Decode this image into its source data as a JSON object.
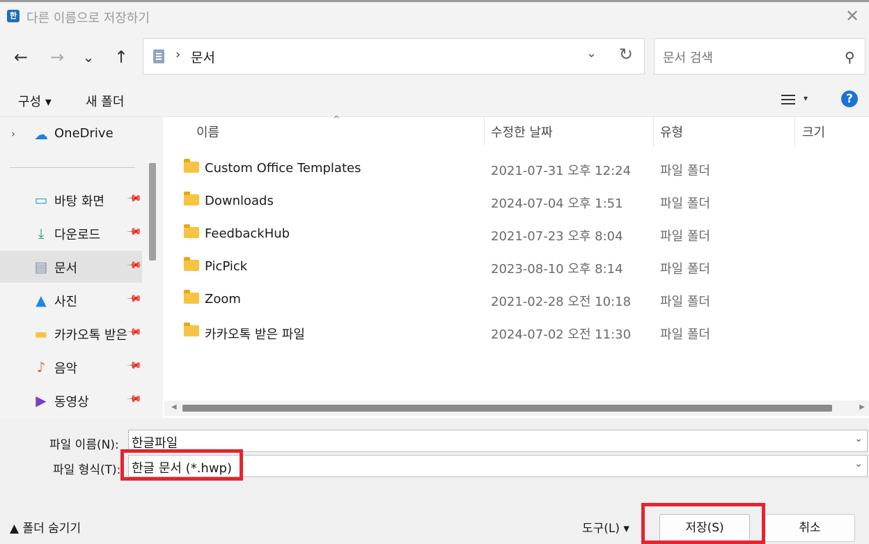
{
  "window": {
    "title": "다른 이름으로 저장하기",
    "app_icon_glyph": "한",
    "close_glyph": "✕"
  },
  "nav": {
    "back_glyph": "←",
    "forward_glyph": "→",
    "recent_glyph": "⌄",
    "up_glyph": "↑",
    "address": {
      "separator": "›",
      "path": "문서",
      "dropdown_glyph": "⌄",
      "refresh_glyph": "↻"
    },
    "search": {
      "placeholder": "문서 검색",
      "icon_glyph": "⚲"
    }
  },
  "commandbar": {
    "organize": "구성 ▾",
    "new_folder": "새 폴더",
    "view_caret": "▾",
    "help_glyph": "?"
  },
  "sidebar": {
    "onedrive": {
      "chevron": "›",
      "label": "OneDrive"
    },
    "items": [
      {
        "label": "바탕 화면",
        "icon": "desktop-icon",
        "pin": "📌",
        "glyph": "▭",
        "color": "#2a9fd8"
      },
      {
        "label": "다운로드",
        "icon": "download-icon",
        "pin": "📌",
        "glyph": "⤓",
        "color": "#2aa06a"
      },
      {
        "label": "문서",
        "icon": "document-icon",
        "pin": "📌",
        "glyph": "▤",
        "color": "#7f93ab"
      },
      {
        "label": "사진",
        "icon": "picture-icon",
        "pin": "📌",
        "glyph": "▲",
        "color": "#1e88e5"
      },
      {
        "label": "카카오톡 받은",
        "icon": "folder-icon",
        "pin": "📌",
        "glyph": "▬",
        "color": "#f6c342"
      },
      {
        "label": "음악",
        "icon": "music-icon",
        "pin": "📌",
        "glyph": "♪",
        "color": "#e06a3b"
      },
      {
        "label": "동영상",
        "icon": "video-icon",
        "pin": "📌",
        "glyph": "▶",
        "color": "#7a3fc0"
      }
    ],
    "selected_index": 2
  },
  "columns": {
    "name": "이름",
    "date": "수정한 날짜",
    "type": "유형",
    "size": "크기",
    "sort_glyph": "^"
  },
  "files": [
    {
      "name": "Custom Office Templates",
      "date": "2021-07-31 오후 12:24",
      "type": "파일 폴더"
    },
    {
      "name": "Downloads",
      "date": "2024-07-04 오후 1:51",
      "type": "파일 폴더"
    },
    {
      "name": "FeedbackHub",
      "date": "2021-07-23 오후 8:04",
      "type": "파일 폴더"
    },
    {
      "name": "PicPick",
      "date": "2023-08-10 오후 8:14",
      "type": "파일 폴더"
    },
    {
      "name": "Zoom",
      "date": "2021-02-28 오전 10:18",
      "type": "파일 폴더"
    },
    {
      "name": "카카오톡 받은 파일",
      "date": "2024-07-02 오전 11:30",
      "type": "파일 폴더"
    }
  ],
  "form": {
    "filename_label": "파일 이름(N):",
    "filename_value": "한글파일",
    "filetype_label": "파일 형식(T):",
    "filetype_value": "한글 문서 (*.hwp)",
    "dropdown_glyph": "⌄"
  },
  "footer": {
    "hide_folders": "▲ 폴더 숨기기",
    "tools": "도구(L)  ▾",
    "save": "저장(S)",
    "cancel": "취소"
  },
  "colors": {
    "highlight": "#e8232e",
    "help": "#1a73d6",
    "folder": "#f6c342"
  }
}
